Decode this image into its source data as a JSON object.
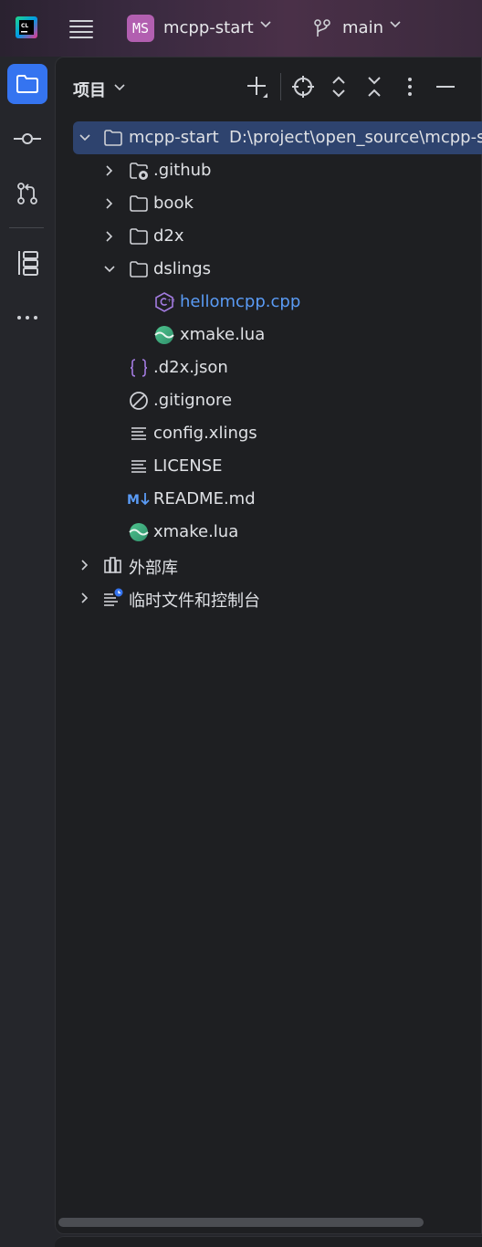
{
  "titlebar": {
    "project_badge": "MS",
    "project_name": "mcpp-start",
    "branch_name": "main"
  },
  "toolbar": {
    "items": [
      "project-view",
      "commit",
      "pull-requests",
      "structure",
      "more"
    ]
  },
  "panel": {
    "title": "项目"
  },
  "tree": {
    "root": {
      "label": "mcpp-start",
      "path": "D:\\project\\open_source\\mcpp-s"
    },
    "items": [
      {
        "label": ".github",
        "icon": "folder-github-icon"
      },
      {
        "label": "book",
        "icon": "folder-icon"
      },
      {
        "label": "d2x",
        "icon": "folder-icon"
      },
      {
        "label": "dslings",
        "icon": "folder-icon"
      },
      {
        "label": "hellomcpp.cpp",
        "icon": "cpp-file-icon"
      },
      {
        "label": "xmake.lua",
        "icon": "lua-file-icon"
      },
      {
        "label": ".d2x.json",
        "icon": "json-file-icon"
      },
      {
        "label": ".gitignore",
        "icon": "ignore-file-icon"
      },
      {
        "label": "config.xlings",
        "icon": "text-file-icon"
      },
      {
        "label": "LICENSE",
        "icon": "text-file-icon"
      },
      {
        "label": "README.md",
        "icon": "markdown-file-icon"
      },
      {
        "label": "xmake.lua",
        "icon": "lua-file-icon"
      },
      {
        "label": "外部库",
        "icon": "library-icon"
      },
      {
        "label": "临时文件和控制台",
        "icon": "scratches-icon"
      }
    ]
  },
  "colors": {
    "accent": "#3574f0",
    "selection": "#2e436e",
    "cpp_file": "#5a9bf5",
    "badge": "#b25fb0"
  }
}
